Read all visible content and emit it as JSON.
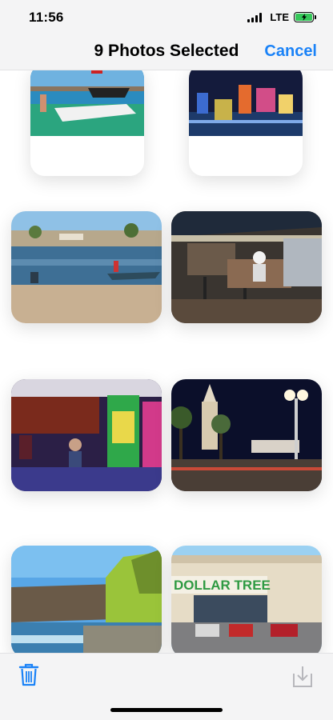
{
  "status_bar": {
    "time": "11:56",
    "network": "LTE",
    "battery_color": "#35c759"
  },
  "nav": {
    "title": "9 Photos Selected",
    "cancel_label": "Cancel",
    "accent_color": "#1a82f7"
  },
  "photos": [
    {
      "name": "boat-on-lake-photo",
      "selected": true
    },
    {
      "name": "city-skyline-night-photo",
      "selected": true
    },
    {
      "name": "beach-river-photo",
      "selected": true
    },
    {
      "name": "bar-interior-photo",
      "selected": true
    },
    {
      "name": "casino-slot-machines-photo",
      "selected": true
    },
    {
      "name": "palm-trees-night-tower-photo",
      "selected": true
    },
    {
      "name": "river-cliff-landscape-photo",
      "selected": true
    },
    {
      "name": "dollar-tree-storefront-photo",
      "selected": true,
      "sign_text": "DOLLAR TREE"
    }
  ],
  "toolbar": {
    "delete_icon": "trash-icon",
    "save_icon": "save-to-files-icon"
  }
}
